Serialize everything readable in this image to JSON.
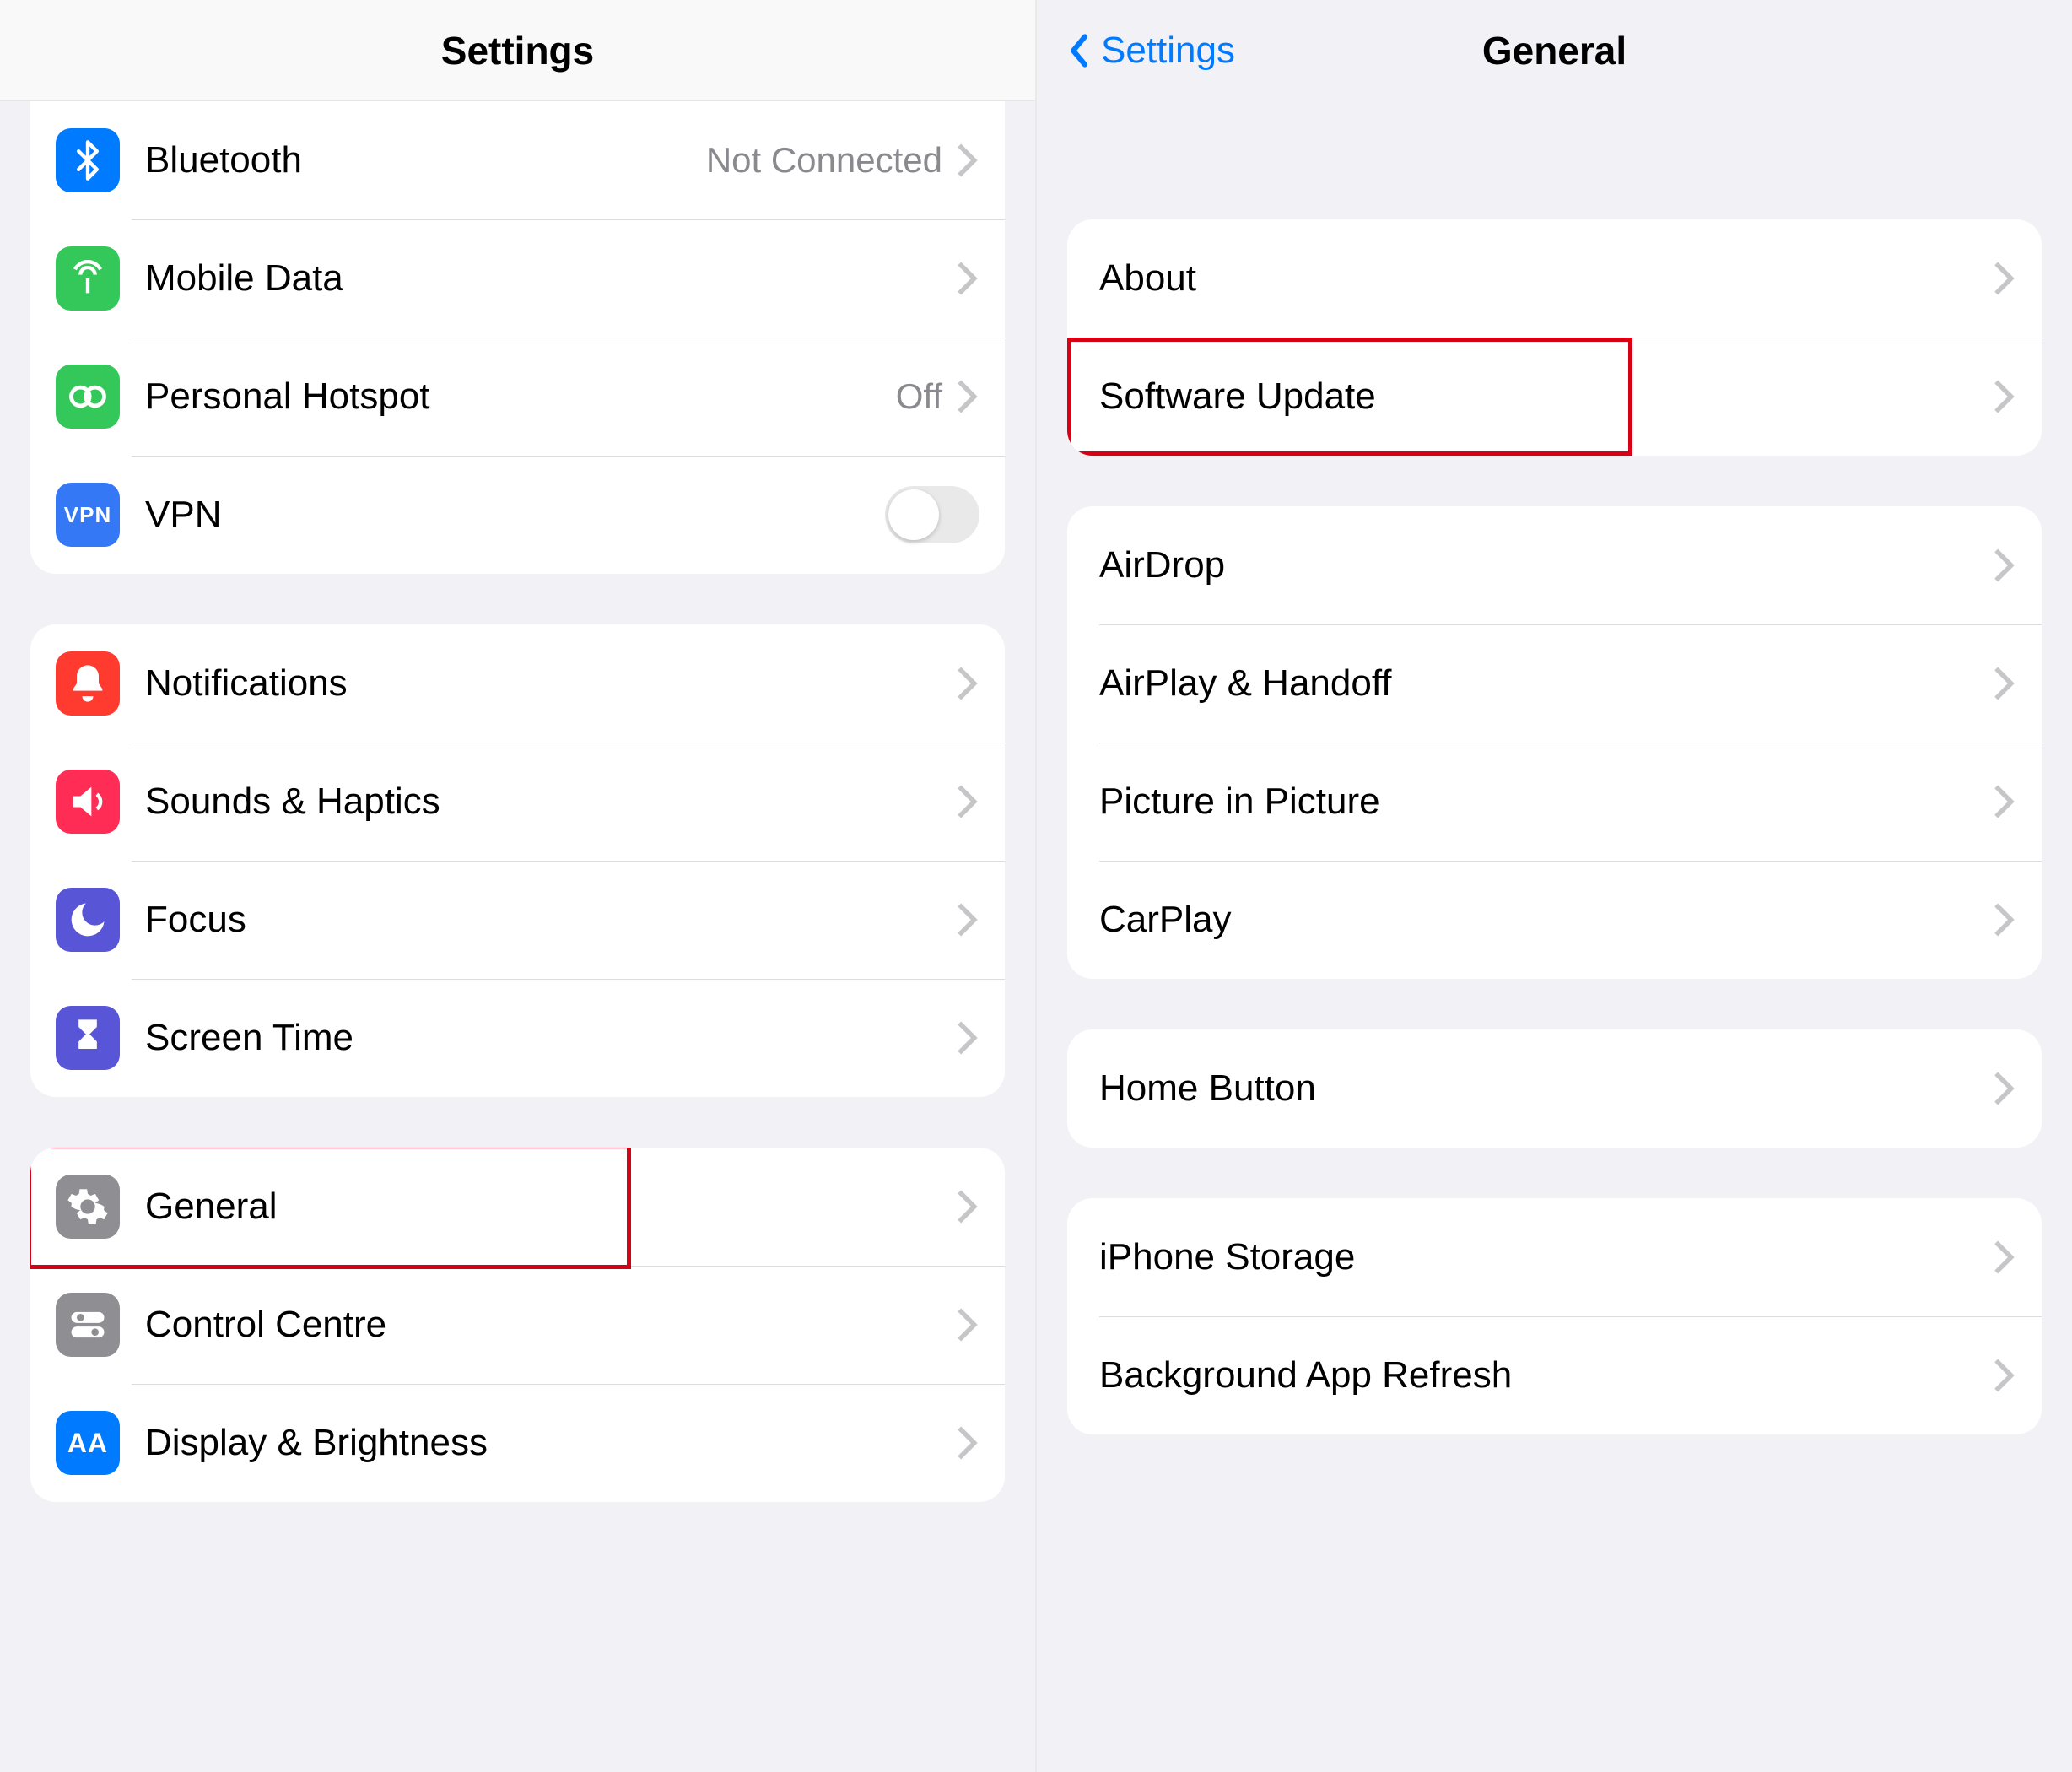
{
  "left": {
    "title": "Settings",
    "groups": [
      {
        "rows": [
          {
            "id": "bluetooth",
            "label": "Bluetooth",
            "value": "Not Connected",
            "icon": "bluetooth",
            "chevron": true
          },
          {
            "id": "mobile-data",
            "label": "Mobile Data",
            "icon": "antenna",
            "chevron": true
          },
          {
            "id": "personal-hotspot",
            "label": "Personal Hotspot",
            "value": "Off",
            "icon": "hotspot",
            "chevron": true
          },
          {
            "id": "vpn",
            "label": "VPN",
            "icon": "vpn",
            "toggle": true,
            "toggleOn": false
          }
        ]
      },
      {
        "rows": [
          {
            "id": "notifications",
            "label": "Notifications",
            "icon": "bell",
            "chevron": true
          },
          {
            "id": "sounds-haptics",
            "label": "Sounds & Haptics",
            "icon": "speaker",
            "chevron": true
          },
          {
            "id": "focus",
            "label": "Focus",
            "icon": "moon",
            "chevron": true
          },
          {
            "id": "screen-time",
            "label": "Screen Time",
            "icon": "hourglass",
            "chevron": true
          }
        ]
      },
      {
        "rows": [
          {
            "id": "general",
            "label": "General",
            "icon": "gear",
            "chevron": true,
            "highlighted": true
          },
          {
            "id": "control-centre",
            "label": "Control Centre",
            "icon": "switches",
            "chevron": true
          },
          {
            "id": "display-brightness",
            "label": "Display & Brightness",
            "icon": "textsize",
            "chevron": true
          }
        ]
      }
    ]
  },
  "right": {
    "backLabel": "Settings",
    "title": "General",
    "groups": [
      {
        "rows": [
          {
            "id": "about",
            "label": "About",
            "chevron": true
          },
          {
            "id": "software-update",
            "label": "Software Update",
            "chevron": true,
            "highlighted": true
          }
        ]
      },
      {
        "rows": [
          {
            "id": "airdrop",
            "label": "AirDrop",
            "chevron": true
          },
          {
            "id": "airplay-handoff",
            "label": "AirPlay & Handoff",
            "chevron": true
          },
          {
            "id": "picture-in-picture",
            "label": "Picture in Picture",
            "chevron": true
          },
          {
            "id": "carplay",
            "label": "CarPlay",
            "chevron": true
          }
        ]
      },
      {
        "rows": [
          {
            "id": "home-button",
            "label": "Home Button",
            "chevron": true
          }
        ]
      },
      {
        "rows": [
          {
            "id": "iphone-storage",
            "label": "iPhone Storage",
            "chevron": true
          },
          {
            "id": "background-app-refresh",
            "label": "Background App Refresh",
            "chevron": true
          }
        ]
      }
    ]
  }
}
